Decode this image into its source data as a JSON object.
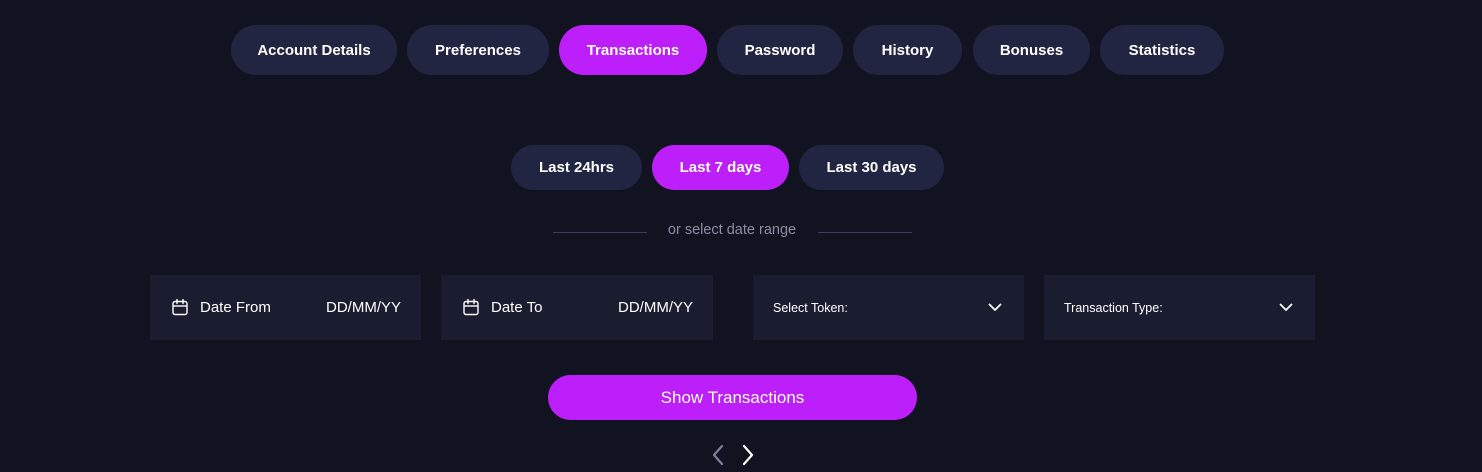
{
  "tabs": [
    {
      "label": "Account Details",
      "active": false
    },
    {
      "label": "Preferences",
      "active": false
    },
    {
      "label": "Transactions",
      "active": true
    },
    {
      "label": "Password",
      "active": false
    },
    {
      "label": "History",
      "active": false
    },
    {
      "label": "Bonuses",
      "active": false
    },
    {
      "label": "Statistics",
      "active": false
    }
  ],
  "periods": [
    {
      "label": "Last 24hrs",
      "active": false
    },
    {
      "label": "Last 7 days",
      "active": true
    },
    {
      "label": "Last 30 days",
      "active": false
    }
  ],
  "divider_text": "or select date range",
  "filters": {
    "date_from": {
      "label": "Date From",
      "value": "DD/MM/YY",
      "icon": "calendar-icon"
    },
    "date_to": {
      "label": "Date To",
      "value": "DD/MM/YY",
      "icon": "calendar-icon"
    },
    "token": {
      "label": "Select Token:",
      "icon": "chevron-down-icon"
    },
    "type": {
      "label": "Transaction Type:",
      "icon": "chevron-down-icon"
    }
  },
  "show_button": "Show Transactions",
  "pager": {
    "prev_icon": "chevron-left-icon",
    "next_icon": "chevron-right-icon"
  },
  "colors": {
    "background": "#111321",
    "pill": "#222542",
    "field": "#1a1c30",
    "accent": "#bd1ffa",
    "muted_text": "#8a8ea3"
  }
}
